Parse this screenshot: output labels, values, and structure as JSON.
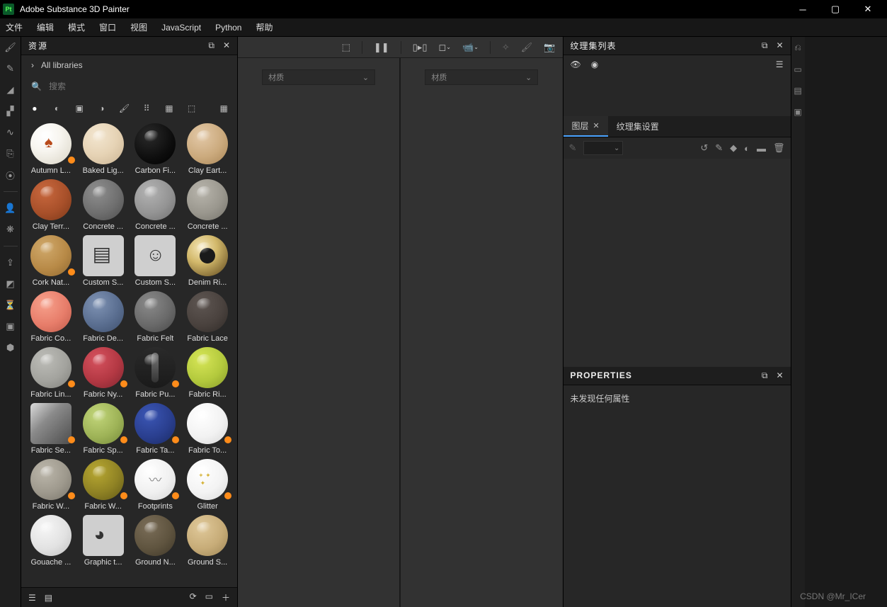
{
  "title": "Adobe Substance 3D Painter",
  "menu": [
    "文件",
    "编辑",
    "模式",
    "窗口",
    "视图",
    "JavaScript",
    "Python",
    "帮助"
  ],
  "assets": {
    "panel_title": "资源",
    "breadcrumb_label": "All libraries",
    "search_placeholder": "搜索",
    "materials": [
      {
        "name": "Autumn L...",
        "bg": "radial-gradient(circle at 35% 30%,#fff,#f7f5ef 40%,#d9d4c5)",
        "leaf": true,
        "tag": true
      },
      {
        "name": "Baked Lig...",
        "bg": "radial-gradient(circle at 35% 30%,#f3e6d0,#e6d3b5 50%,#c9b393)"
      },
      {
        "name": "Carbon Fi...",
        "bg": "radial-gradient(circle at 35% 30%,#2a2a2a,#0d0d0d 60%,#000)"
      },
      {
        "name": "Clay Eart...",
        "bg": "radial-gradient(circle at 35% 30%,#e3c9a8,#cbaa7d 55%,#a88556)"
      },
      {
        "name": "Clay Terr...",
        "bg": "radial-gradient(circle at 35% 30%,#c9683e,#a8502a 55%,#7a3819)"
      },
      {
        "name": "Concrete ...",
        "bg": "radial-gradient(circle at 35% 30%,#8f8f8f,#6f6f6f 55%,#4d4d4d)"
      },
      {
        "name": "Concrete ...",
        "bg": "radial-gradient(circle at 35% 30%,#b3b3b3,#949494 55%,#6e6e6e)"
      },
      {
        "name": "Concrete ...",
        "bg": "radial-gradient(circle at 35% 30%,#b8b5ac,#9a978e 55%,#74726a)"
      },
      {
        "name": "Cork Nat...",
        "bg": "radial-gradient(circle at 35% 30%,#d0a96b,#b88a47 55%,#8f6830)",
        "tag": true
      },
      {
        "name": "Custom S...",
        "bg": "#cfcfcf",
        "square": true,
        "iconC": true
      },
      {
        "name": "Custom S...",
        "bg": "#cfcfcf",
        "square": true,
        "iconS": true
      },
      {
        "name": "Denim Ri...",
        "bg": "radial-gradient(circle at 35% 30%,#f5e6b8,#d2b86a 40%,#5a431a)",
        "ring": true
      },
      {
        "name": "Fabric Co...",
        "bg": "radial-gradient(circle at 35% 30%,#f7a18c,#e77d6a 55%,#bd5a4a)"
      },
      {
        "name": "Fabric De...",
        "bg": "radial-gradient(circle at 35% 30%,#7f93b4,#5a6e90 55%,#3e4f6c)"
      },
      {
        "name": "Fabric Felt",
        "bg": "radial-gradient(circle at 35% 30%,#8a8a8a,#6a6a6a 55%,#474747)"
      },
      {
        "name": "Fabric Lace",
        "bg": "radial-gradient(circle at 35% 30%,#5e5652,#4a423e 55%,#2f2a27)"
      },
      {
        "name": "Fabric Lin...",
        "bg": "radial-gradient(circle at 35% 30%,#bdbdb8,#a3a39e 55%,#7f7f7a)",
        "tag": true
      },
      {
        "name": "Fabric Ny...",
        "bg": "radial-gradient(circle at 35% 30%,#d6525e,#b33843 55%,#7e2630)",
        "tag": true
      },
      {
        "name": "Fabric Pu...",
        "bg": "linear-gradient(#2a2a2a,#1a1a1a)",
        "puff": true,
        "tag": true
      },
      {
        "name": "Fabric Ri...",
        "bg": "radial-gradient(circle at 35% 30%,#d7e657,#b3c93d 55%,#87992a)"
      },
      {
        "name": "Fabric Se...",
        "bg": "linear-gradient(135deg,#dcdcdc,#8a8a8a 40%,#4d4d4d)",
        "square": true,
        "tag": true
      },
      {
        "name": "Fabric Sp...",
        "bg": "radial-gradient(circle at 35% 30%,#c2d67a,#9eb357 55%,#758a3a)",
        "tag": true
      },
      {
        "name": "Fabric Ta...",
        "bg": "radial-gradient(circle at 35% 30%,#3b56b5,#2a3f8f 55%,#1a2a63)",
        "tag": true
      },
      {
        "name": "Fabric To...",
        "bg": "radial-gradient(circle at 35% 30%,#fff,#f2f2f2 55%,#d6d6d6)",
        "tag": true
      },
      {
        "name": "Fabric W...",
        "bg": "radial-gradient(circle at 35% 30%,#bcb7ab,#9e998d 55%,#78746a)",
        "tag": true
      },
      {
        "name": "Fabric W...",
        "bg": "radial-gradient(circle at 35% 30%,#b8a832,#8f8224 55%,#615817)",
        "tag": true
      },
      {
        "name": "Footprints",
        "bg": "radial-gradient(circle at 35% 30%,#fff,#f0f0f0 55%,#d4d4d4)",
        "foot": true,
        "tag": true
      },
      {
        "name": "Glitter",
        "bg": "radial-gradient(circle at 35% 30%,#fff,#f3f3f3 55%,#d8d8d8)",
        "tag": true,
        "glitter": true
      },
      {
        "name": "Gouache ...",
        "bg": "radial-gradient(circle at 35% 30%,#f6f6f6,#e2e2e2 55%,#bfbfbf)"
      },
      {
        "name": "Graphic t...",
        "bg": "#cfcfcf",
        "square": true,
        "iconG": true
      },
      {
        "name": "Ground N...",
        "bg": "radial-gradient(circle at 35% 30%,#7a6d58,#5f543f 55%,#3e3628)"
      },
      {
        "name": "Ground S...",
        "bg": "radial-gradient(circle at 35% 30%,#e0c99a,#c7ac78 55%,#9c8454)"
      }
    ]
  },
  "viewport": {
    "dropdown_label": "材质"
  },
  "right": {
    "texset_title": "纹理集列表",
    "layers_tab": "图层",
    "texset_settings_tab": "纹理集设置",
    "properties_title": "PROPERTIES",
    "properties_empty": "未发现任何属性"
  },
  "watermark": "CSDN @Mr_ICer"
}
